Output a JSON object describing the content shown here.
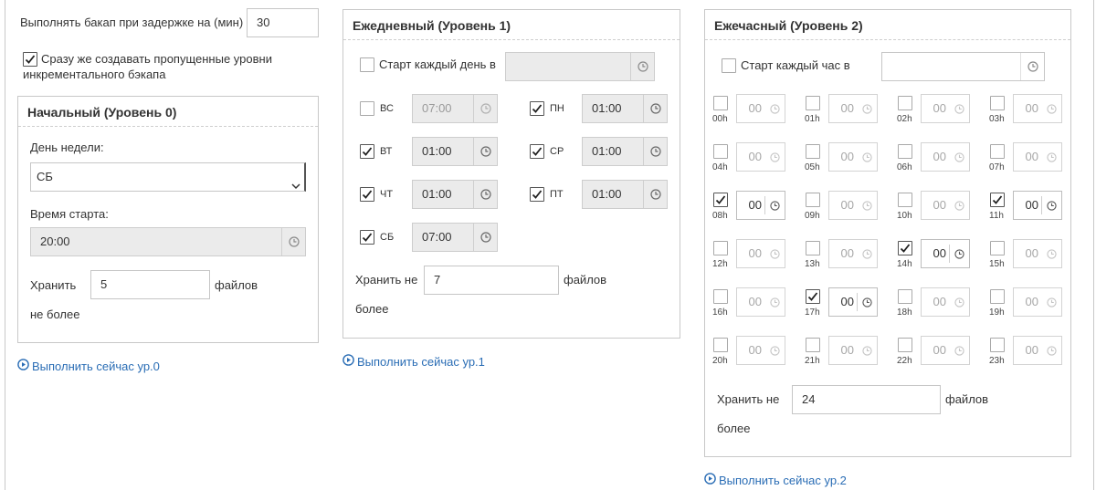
{
  "top": {
    "delay_label": "Выполнять бакап при задержке на (мин)",
    "delay_value": "30",
    "catchup_label_line1": "Сразу же создавать пропущенные уровни",
    "catchup_label_line2": "инкрементального бэкапа",
    "catchup_checked": true
  },
  "level0": {
    "title": "Начальный (Уровень 0)",
    "weekday_label": "День недели:",
    "weekday_value": "СБ",
    "start_label": "Время старта:",
    "start_value": "20:00",
    "keep_label": "Хранить",
    "keep_value": "5",
    "keep_suffix": "файлов",
    "keep_tail": "не более",
    "run_now": "Выполнить сейчас ур.0"
  },
  "level1": {
    "title": "Ежедневный (Уровень 1)",
    "every_day_label": "Старт каждый день в",
    "every_day_value": "",
    "days": [
      {
        "name": "ВС",
        "checked": false,
        "time": "07:00"
      },
      {
        "name": "ПН",
        "checked": true,
        "time": "01:00"
      },
      {
        "name": "ВТ",
        "checked": true,
        "time": "01:00"
      },
      {
        "name": "СР",
        "checked": true,
        "time": "01:00"
      },
      {
        "name": "ЧТ",
        "checked": true,
        "time": "01:00"
      },
      {
        "name": "ПТ",
        "checked": true,
        "time": "01:00"
      },
      {
        "name": "СБ",
        "checked": true,
        "time": "07:00"
      }
    ],
    "keep_label": "Хранить не",
    "keep_value": "7",
    "keep_suffix": "файлов",
    "keep_tail": "более",
    "run_now": "Выполнить сейчас ур.1"
  },
  "level2": {
    "title": "Ежечасный (Уровень 2)",
    "every_hour_label": "Старт каждый час в",
    "every_hour_value": "",
    "hours": [
      {
        "label": "00h",
        "checked": false,
        "value": "00"
      },
      {
        "label": "01h",
        "checked": false,
        "value": "00"
      },
      {
        "label": "02h",
        "checked": false,
        "value": "00"
      },
      {
        "label": "03h",
        "checked": false,
        "value": "00"
      },
      {
        "label": "04h",
        "checked": false,
        "value": "00"
      },
      {
        "label": "05h",
        "checked": false,
        "value": "00"
      },
      {
        "label": "06h",
        "checked": false,
        "value": "00"
      },
      {
        "label": "07h",
        "checked": false,
        "value": "00"
      },
      {
        "label": "08h",
        "checked": true,
        "value": "00"
      },
      {
        "label": "09h",
        "checked": false,
        "value": "00"
      },
      {
        "label": "10h",
        "checked": false,
        "value": "00"
      },
      {
        "label": "11h",
        "checked": true,
        "value": "00"
      },
      {
        "label": "12h",
        "checked": false,
        "value": "00"
      },
      {
        "label": "13h",
        "checked": false,
        "value": "00"
      },
      {
        "label": "14h",
        "checked": true,
        "value": "00"
      },
      {
        "label": "15h",
        "checked": false,
        "value": "00"
      },
      {
        "label": "16h",
        "checked": false,
        "value": "00"
      },
      {
        "label": "17h",
        "checked": true,
        "value": "00"
      },
      {
        "label": "18h",
        "checked": false,
        "value": "00"
      },
      {
        "label": "19h",
        "checked": false,
        "value": "00"
      },
      {
        "label": "20h",
        "checked": false,
        "value": "00"
      },
      {
        "label": "21h",
        "checked": false,
        "value": "00"
      },
      {
        "label": "22h",
        "checked": false,
        "value": "00"
      },
      {
        "label": "23h",
        "checked": false,
        "value": "00"
      }
    ],
    "keep_label": "Хранить не",
    "keep_value": "24",
    "keep_suffix": "файлов",
    "keep_tail": "более",
    "run_now": "Выполнить сейчас ур.2"
  },
  "colors": {
    "link": "#2a6db5",
    "border": "#c8c8c8",
    "readonly_bg": "#ebebeb"
  },
  "icons": {
    "clock": "clock-icon",
    "check": "checkmark-icon",
    "play": "play-circle-icon",
    "dropdown": "chevron-down-icon"
  }
}
